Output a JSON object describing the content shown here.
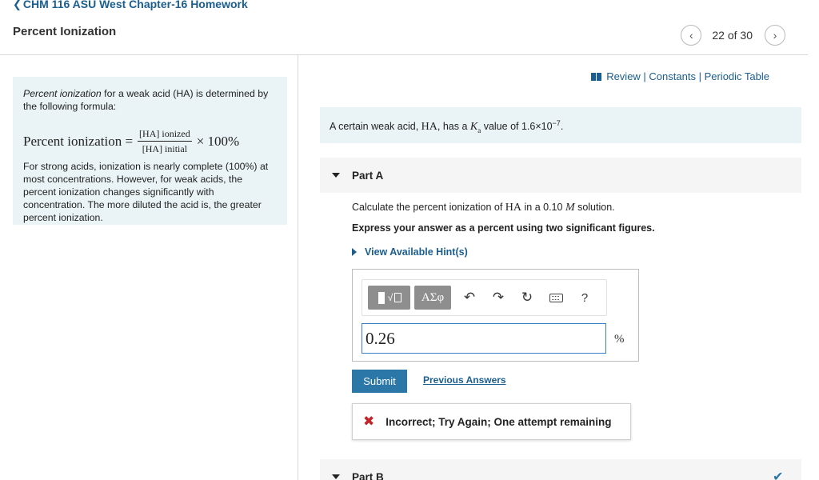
{
  "header": {
    "course_link": "CHM 116 ASU West Chapter-16 Homework",
    "course_link_icon": "chevron-left-icon",
    "title": "Percent Ionization",
    "pager_text": "22 of 30",
    "prev_icon": "chevron-left-icon",
    "next_icon": "chevron-right-icon"
  },
  "intro": {
    "paragraph1_em": "Percent ionization",
    "paragraph1_rest": " for a weak acid (HA) is determined by the following formula:",
    "formula_lhs": "Percent ionization =",
    "formula_num": "[HA] ionized",
    "formula_den": "[HA] initial",
    "formula_rhs": "× 100%",
    "paragraph2": "For strong acids, ionization is nearly complete (100%) at most concentrations. However, for weak acids, the percent ionization changes significantly with concentration. The more diluted the acid is, the greater percent ionization."
  },
  "links": {
    "icon": "book-icon",
    "review": "Review",
    "sep": " | ",
    "constants": "Constants",
    "periodic_table": "Periodic Table"
  },
  "question": {
    "text_before": "A certain weak acid, ",
    "acid": "HA",
    "text_mid": ", has a ",
    "ka_symbol": "Ka",
    "text_after": " value of 1.6×10",
    "exponent": "−7",
    "text_end": "."
  },
  "part_a": {
    "title": "Part A",
    "calc_before": "Calculate the percent ionization of ",
    "calc_acid": "HA",
    "calc_mid": " in a 0.10 ",
    "calc_unit": "M",
    "calc_after": " solution.",
    "express": "Express your answer as a percent using two significant figures.",
    "hint": "View Available Hint(s)",
    "toolbar": {
      "greek_label": "ΑΣφ",
      "help_label": "?",
      "undo_icon": "undo-icon",
      "redo_icon": "redo-icon",
      "reset_icon": "reset-icon",
      "keyboard_icon": "keyboard-icon"
    },
    "answer_value": "0.26",
    "unit": "%",
    "submit_label": "Submit",
    "previous_answers": "Previous Answers",
    "feedback": "Incorrect; Try Again; One attempt remaining"
  },
  "part_b": {
    "title": "Part B"
  },
  "colors": {
    "link": "#1a5e8f",
    "panel_bg": "#eaf4f7",
    "submit_bg": "#2b78a8",
    "error": "#c0262c"
  }
}
